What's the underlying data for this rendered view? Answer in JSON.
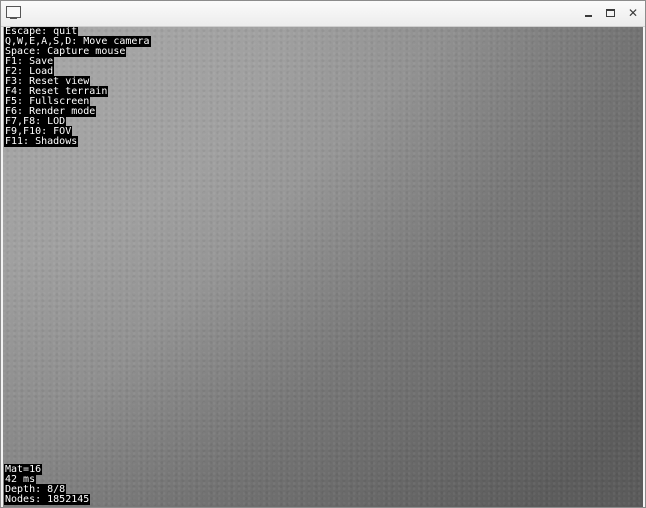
{
  "help_lines": [
    "Escape: quit",
    "Q,W,E,A,S,D: Move camera",
    "Space: Capture mouse",
    "F1: Save",
    "F2: Load",
    "F3: Reset view",
    "F4: Reset terrain",
    "F5: Fullscreen",
    "F6: Render mode",
    "F7,F8: LOD",
    "F9,F10: FOV",
    "F11: Shadows"
  ],
  "stats": {
    "mat": "Mat=16",
    "frame_time": "42 ms",
    "depth": "Depth: 8/8",
    "nodes": "Nodes: 1852145"
  },
  "window_controls": {
    "minimize_icon": "minimize-icon",
    "maximize_icon": "maximize-icon",
    "close_icon": "close-icon",
    "close_glyph": "✕"
  },
  "colors": {
    "overlay_text": "#ffffff",
    "overlay_bg": "#000000",
    "terrain": "#9a9a9a"
  }
}
